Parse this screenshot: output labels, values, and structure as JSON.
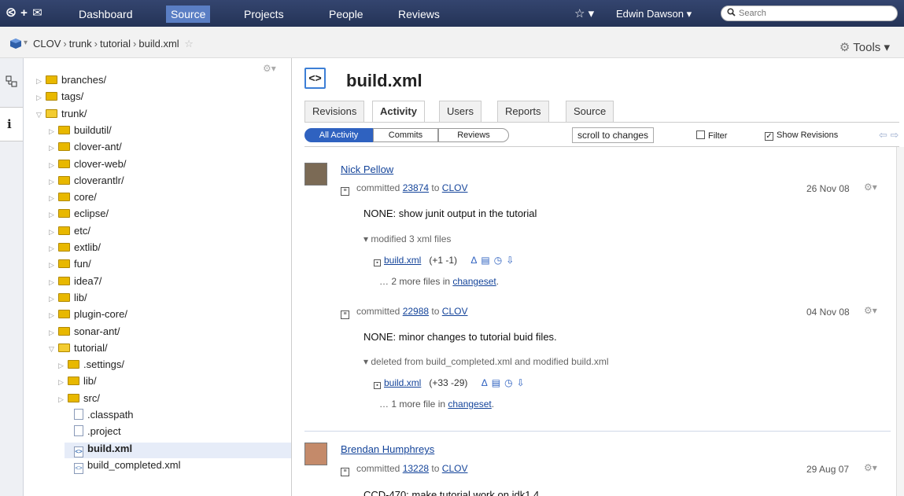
{
  "topnav": {
    "logo": "⧀ + ✉",
    "items": [
      {
        "label": "Dashboard",
        "active": false
      },
      {
        "label": "Source",
        "active": true
      },
      {
        "label": "Projects",
        "active": false
      },
      {
        "label": "People",
        "active": false
      },
      {
        "label": "Reviews",
        "active": false
      }
    ],
    "favorites_icon": "☆ ▾",
    "user": "Edwin Dawson ▾",
    "search_placeholder": "Search"
  },
  "breadcrumb": {
    "items": [
      "CLOV",
      "trunk",
      "tutorial",
      "build.xml"
    ],
    "separator": "›"
  },
  "tools_label": "Tools ▾",
  "tree": [
    {
      "label": "branches/",
      "kind": "folder"
    },
    {
      "label": "tags/",
      "kind": "folder"
    },
    {
      "label": "trunk/",
      "kind": "folder-open"
    },
    {
      "label": "buildutil/",
      "kind": "folder"
    },
    {
      "label": "clover-ant/",
      "kind": "folder"
    },
    {
      "label": "clover-web/",
      "kind": "folder"
    },
    {
      "label": "cloverantlr/",
      "kind": "folder"
    },
    {
      "label": "core/",
      "kind": "folder"
    },
    {
      "label": "eclipse/",
      "kind": "folder"
    },
    {
      "label": "etc/",
      "kind": "folder"
    },
    {
      "label": "extlib/",
      "kind": "folder"
    },
    {
      "label": "fun/",
      "kind": "folder"
    },
    {
      "label": "idea7/",
      "kind": "folder"
    },
    {
      "label": "lib/",
      "kind": "folder"
    },
    {
      "label": "plugin-core/",
      "kind": "folder"
    },
    {
      "label": "sonar-ant/",
      "kind": "folder"
    },
    {
      "label": "tutorial/",
      "kind": "folder-open"
    },
    {
      "label": ".settings/",
      "kind": "folder"
    },
    {
      "label": "lib/",
      "kind": "folder"
    },
    {
      "label": "src/",
      "kind": "folder"
    },
    {
      "label": ".classpath",
      "kind": "file"
    },
    {
      "label": ".project",
      "kind": "file"
    },
    {
      "label": "build.xml",
      "kind": "xml"
    },
    {
      "label": "build_completed.xml",
      "kind": "xml"
    }
  ],
  "file_title": "build.xml",
  "tabs": [
    {
      "label": "Revisions",
      "active": false
    },
    {
      "label": "Activity",
      "active": true
    },
    {
      "label": "Users",
      "active": false
    },
    {
      "label": "Reports",
      "active": false
    },
    {
      "label": "Source",
      "active": false
    }
  ],
  "filters": {
    "all": "All Activity",
    "commits": "Commits",
    "reviews": "Reviews",
    "scroll": "scroll to changes",
    "filter": "Filter",
    "show_revisions": "Show Revisions",
    "show_revisions_checked": true,
    "filter_checked": false
  },
  "activity": [
    {
      "author": "Nick Pellow",
      "commit_prefix": "committed",
      "rev": "23874",
      "to": "to",
      "project": "CLOV",
      "date": "26 Nov 08",
      "message": "NONE: show junit output in the tutorial",
      "files_head": "▾ modified 3 xml files",
      "file": "build.xml",
      "diff": "(+1 -1)",
      "more_prefix": "… 2 more files in",
      "more_link": "changeset",
      "more_suffix": "."
    },
    {
      "author": "",
      "commit_prefix": "committed",
      "rev": "22988",
      "to": "to",
      "project": "CLOV",
      "date": "04 Nov 08",
      "message": "NONE: minor changes to tutorial buid files.",
      "files_head": "▾ deleted from build_completed.xml and modified build.xml",
      "file": "build.xml",
      "diff": "(+33 -29)",
      "more_prefix": "… 1 more file in",
      "more_link": "changeset",
      "more_suffix": "."
    },
    {
      "author": "Brendan Humphreys",
      "commit_prefix": "committed",
      "rev": "13228",
      "to": "to",
      "project": "CLOV",
      "date": "29 Aug 07",
      "message": "CCD-470: make tutorial work on jdk1.4"
    }
  ]
}
